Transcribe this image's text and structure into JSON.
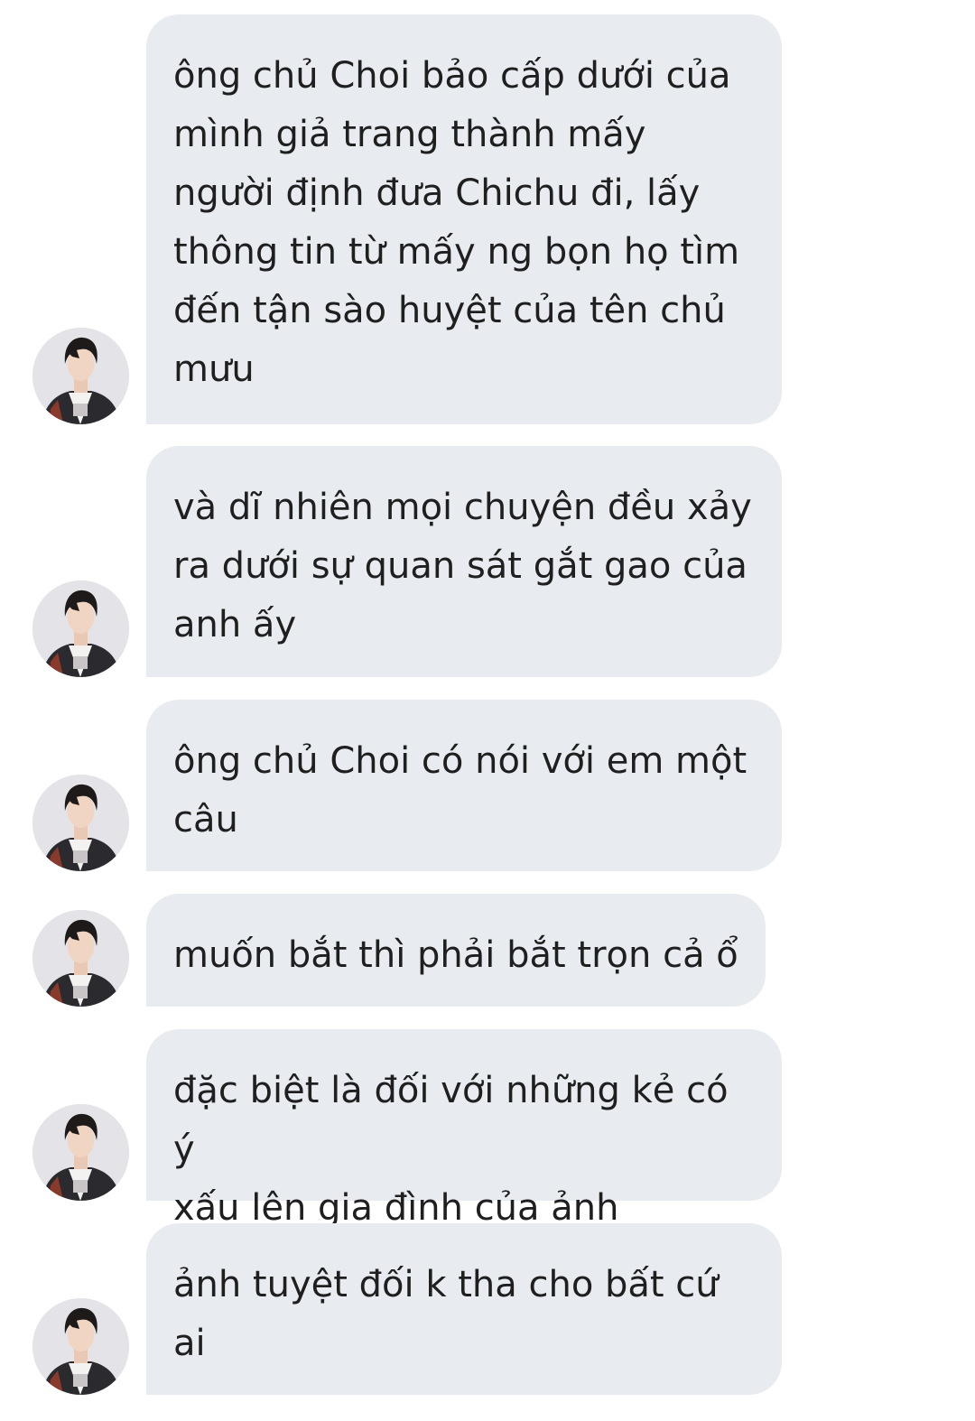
{
  "messages": [
    {
      "text": "ông chủ Choi bảo cấp dưới của\nmình giả trang thành mấy\nngười định đưa Chichu đi, lấy\nthông tin từ mấy ng bọn họ tìm\nđến tận sào huyệt của tên chủ\nmưu"
    },
    {
      "text": "và dĩ nhiên mọi chuyện đều xảy\nra dưới sự quan sát gắt gao của\nanh ấy"
    },
    {
      "text": "ông chủ Choi có nói với em một\ncâu"
    },
    {
      "text": "muốn bắt thì phải bắt trọn cả ổ"
    },
    {
      "text": "đặc biệt là đối với những kẻ có ý\nxấu lên gia đình của ảnh"
    },
    {
      "text": "ảnh tuyệt đối k tha cho bất cứ\nai"
    }
  ],
  "colors": {
    "bubble": "#e8ecf1",
    "text": "#1f1f1f",
    "background": "#ffffff"
  },
  "icons": {
    "sender_avatar": "profile-photo"
  }
}
